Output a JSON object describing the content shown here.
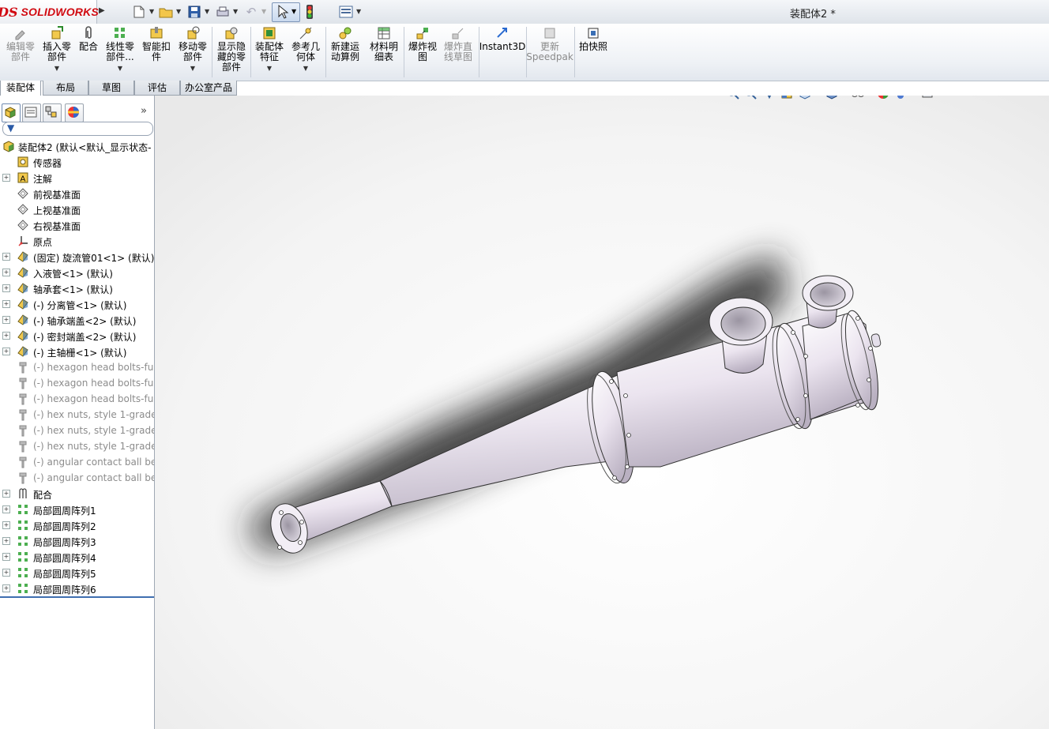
{
  "window": {
    "title": "装配体2 *",
    "brand": "SOLIDWORKS",
    "logo_mark": "DS"
  },
  "quick_access": [
    {
      "name": "new-document-icon"
    },
    {
      "name": "open-folder-icon"
    },
    {
      "name": "save-icon"
    },
    {
      "name": "print-icon"
    },
    {
      "name": "undo-icon"
    },
    {
      "name": "select-cursor-icon"
    },
    {
      "name": "rebuild-traffic-light-icon"
    },
    {
      "name": "options-icon"
    }
  ],
  "commands": {
    "edit_component": "编辑零\n部件",
    "insert_component": "插入零\n部件",
    "mate": "配合",
    "linear_pattern": "线性零\n部件...",
    "smart_fasteners": "智能扣\n件",
    "move_component": "移动零\n部件",
    "show_hidden": "显示隐\n藏的零\n部件",
    "assembly_features": "装配体\n特征",
    "reference_geometry": "参考几\n何体",
    "new_motion_study": "新建运\n动算例",
    "bill_of_materials": "材料明\n细表",
    "exploded_view": "爆炸视\n图",
    "explode_line_sketch": "爆炸直\n线草图",
    "instant3d": "Instant3D",
    "update_speedpak": "更新\nSpeedpak",
    "snapshot": "拍快照"
  },
  "tabs": [
    "装配体",
    "布局",
    "草图",
    "评估",
    "办公室产品"
  ],
  "feature_tree": {
    "root": "装配体2 (默认<默认_显示状态-",
    "items": [
      {
        "label": "传感器",
        "icon": "sensor-icon",
        "expand": false,
        "grey": false
      },
      {
        "label": "注解",
        "icon": "annotation-icon",
        "expand": true,
        "grey": false
      },
      {
        "label": "前视基准面",
        "icon": "plane-icon",
        "expand": false,
        "grey": false
      },
      {
        "label": "上视基准面",
        "icon": "plane-icon",
        "expand": false,
        "grey": false
      },
      {
        "label": "右视基准面",
        "icon": "plane-icon",
        "expand": false,
        "grey": false
      },
      {
        "label": "原点",
        "icon": "origin-icon",
        "expand": false,
        "grey": false
      },
      {
        "label": "(固定) 旋流管01<1> (默认)",
        "icon": "part-icon",
        "expand": true,
        "grey": false
      },
      {
        "label": "入液管<1> (默认)",
        "icon": "part-icon",
        "expand": true,
        "grey": false
      },
      {
        "label": "轴承套<1> (默认)",
        "icon": "part-icon",
        "expand": true,
        "grey": false
      },
      {
        "label": "(-) 分离管<1> (默认)",
        "icon": "part-icon",
        "expand": true,
        "grey": false
      },
      {
        "label": "(-) 轴承端盖<2> (默认)",
        "icon": "part-icon",
        "expand": true,
        "grey": false
      },
      {
        "label": "(-) 密封端盖<2> (默认)",
        "icon": "part-icon",
        "expand": true,
        "grey": false
      },
      {
        "label": "(-) 主轴栅<1> (默认)",
        "icon": "part-icon",
        "expand": true,
        "grey": false
      },
      {
        "label": "(-) hexagon head bolts-ful",
        "icon": "toolbox-part-icon",
        "expand": false,
        "grey": true
      },
      {
        "label": "(-) hexagon head bolts-ful",
        "icon": "toolbox-part-icon",
        "expand": false,
        "grey": true
      },
      {
        "label": "(-) hexagon head bolts-ful",
        "icon": "toolbox-part-icon",
        "expand": false,
        "grey": true
      },
      {
        "label": "(-) hex nuts, style 1-grade",
        "icon": "toolbox-part-icon",
        "expand": false,
        "grey": true
      },
      {
        "label": "(-) hex nuts, style 1-grade",
        "icon": "toolbox-part-icon",
        "expand": false,
        "grey": true
      },
      {
        "label": "(-) hex nuts, style 1-grade",
        "icon": "toolbox-part-icon",
        "expand": false,
        "grey": true
      },
      {
        "label": "(-) angular contact ball be",
        "icon": "toolbox-part-icon",
        "expand": false,
        "grey": true
      },
      {
        "label": "(-) angular contact ball be",
        "icon": "toolbox-part-icon",
        "expand": false,
        "grey": true
      },
      {
        "label": "配合",
        "icon": "mates-icon",
        "expand": true,
        "grey": false
      },
      {
        "label": "局部圆周阵列1",
        "icon": "circular-pattern-icon",
        "expand": true,
        "grey": false
      },
      {
        "label": "局部圆周阵列2",
        "icon": "circular-pattern-icon",
        "expand": true,
        "grey": false
      },
      {
        "label": "局部圆周阵列3",
        "icon": "circular-pattern-icon",
        "expand": true,
        "grey": false
      },
      {
        "label": "局部圆周阵列4",
        "icon": "circular-pattern-icon",
        "expand": true,
        "grey": false
      },
      {
        "label": "局部圆周阵列5",
        "icon": "circular-pattern-icon",
        "expand": true,
        "grey": false
      },
      {
        "label": "局部圆周阵列6",
        "icon": "circular-pattern-icon",
        "expand": true,
        "grey": false
      }
    ]
  },
  "panel_tabs": [
    "feature-manager-icon",
    "property-manager-icon",
    "configuration-manager-icon",
    "display-manager-icon"
  ],
  "heads_up_toolbar": [
    "zoom-to-fit-icon",
    "zoom-area-icon",
    "previous-view-icon",
    "section-view-icon",
    "view-orientation-icon",
    "display-style-icon",
    "hide-show-items-icon",
    "edit-appearance-icon",
    "apply-scene-icon",
    "view-settings-icon"
  ],
  "colors": {
    "accent": "#3f6fb0",
    "brand_red": "#d10a11",
    "part_body": "#ebe6ef"
  }
}
